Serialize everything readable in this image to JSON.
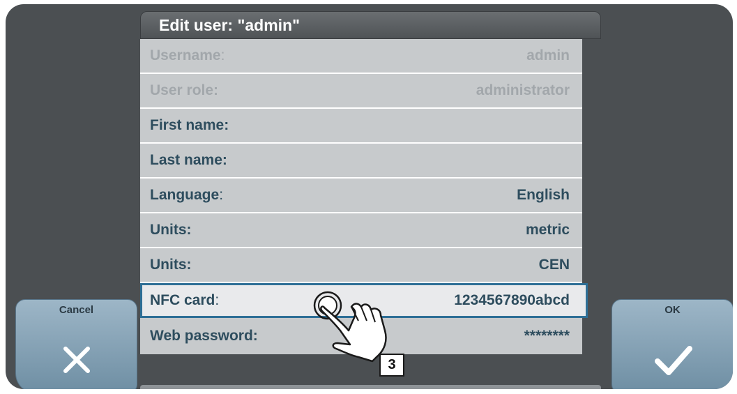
{
  "dialog": {
    "title": "Edit user: \"admin\""
  },
  "fields": [
    {
      "label": "Username",
      "colon": ":",
      "value": "admin",
      "state": "disabled"
    },
    {
      "label": "User role:",
      "colon": "",
      "value": "administrator",
      "state": "disabled"
    },
    {
      "label": "First name:",
      "colon": "",
      "value": "",
      "state": "normal"
    },
    {
      "label": "Last name:",
      "colon": "",
      "value": "",
      "state": "normal"
    },
    {
      "label": "Language",
      "colon": ":",
      "value": "English",
      "state": "normal"
    },
    {
      "label": "Units:",
      "colon": "",
      "value": "metric",
      "state": "normal"
    },
    {
      "label": "Units:",
      "colon": "",
      "value": "CEN",
      "state": "normal"
    },
    {
      "label": "NFC card",
      "colon": ":",
      "value": "1234567890abcd",
      "state": "selected"
    },
    {
      "label": "Web password:",
      "colon": "",
      "value": "********",
      "state": "normal"
    }
  ],
  "buttons": {
    "cancel_label": "Cancel",
    "ok_label": "OK"
  },
  "callout": {
    "number": "3"
  },
  "icons": {
    "cancel": "close-x-icon",
    "ok": "checkmark-icon",
    "pointer": "tapping-hand-icon"
  },
  "colors": {
    "frame": "#4b4f52",
    "form_bg": "#c7cacc",
    "text": "#2e4d5e",
    "disabled_text": "#a2a7ab",
    "selection_border": "#2e6f96",
    "button_bg": "#8aa6b9"
  }
}
